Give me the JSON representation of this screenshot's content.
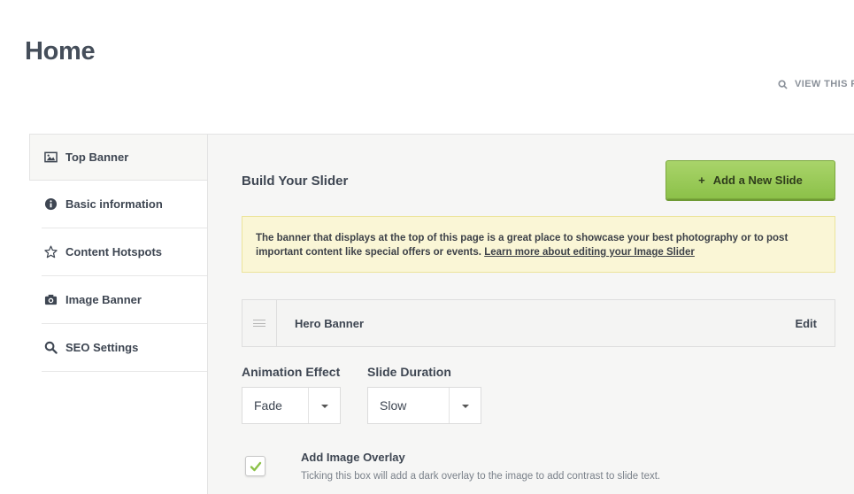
{
  "page": {
    "title": "Home"
  },
  "view_link": {
    "label": "VIEW THIS P"
  },
  "sidebar": {
    "items": [
      {
        "label": "Top Banner",
        "icon": "image-icon",
        "active": true
      },
      {
        "label": "Basic information",
        "icon": "info-icon",
        "active": false
      },
      {
        "label": "Content Hotspots",
        "icon": "star-icon",
        "active": false
      },
      {
        "label": "Image Banner",
        "icon": "camera-icon",
        "active": false
      },
      {
        "label": "SEO Settings",
        "icon": "search-icon",
        "active": false
      }
    ]
  },
  "main": {
    "section_title": "Build Your Slider",
    "add_button": {
      "icon": "+",
      "label": "Add a New Slide"
    },
    "notice": {
      "text": "The banner that displays at the top of this page is a great place to showcase your best photography or to post important content like special offers or events. ",
      "link": "Learn more about editing your Image Slider"
    },
    "slides": [
      {
        "name": "Hero Banner",
        "action": "Edit"
      }
    ],
    "animation": {
      "label": "Animation Effect",
      "value": "Fade"
    },
    "duration": {
      "label": "Slide Duration",
      "value": "Slow"
    },
    "overlay": {
      "label": "Add Image Overlay",
      "help": "Ticking this box will add a dark overlay to the image to add contrast to slide text.",
      "checked": true
    }
  },
  "colors": {
    "accent_green": "#8cc149",
    "notice_bg": "#faf6d6",
    "check_green": "#8cc149"
  }
}
